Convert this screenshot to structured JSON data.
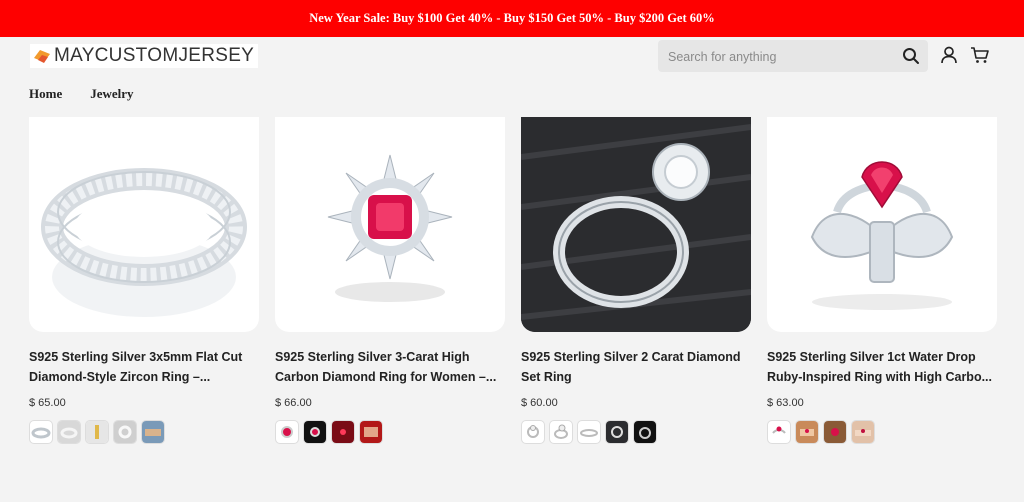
{
  "promo_banner": {
    "text": "New Year Sale: Buy $100 Get 40% - Buy $150 Get 50% - Buy $200 Get 60%",
    "background": "#fe0000"
  },
  "header": {
    "logo_text": "MAYCUSTOMJERSEY",
    "search_placeholder": "Search for anything",
    "icons": [
      "search-icon",
      "user-icon",
      "cart-icon"
    ]
  },
  "nav": {
    "items": [
      {
        "label": "Home"
      },
      {
        "label": "Jewelry"
      }
    ]
  },
  "products": [
    {
      "title": "S925 Sterling Silver 3x5mm Flat Cut Diamond-Style Zircon Ring –...",
      "price": "$ 65.00",
      "image": "eternity-band-ring",
      "swatches": [
        "silver-band",
        "band-on-gray",
        "band-with-gold",
        "band-in-box",
        "band-on-hand"
      ]
    },
    {
      "title": "S925 Sterling Silver 3-Carat High Carbon Diamond Ring for Women –...",
      "price": "$ 66.00",
      "image": "ruby-halo-ring",
      "swatches": [
        "ruby-ring-white",
        "ruby-ring-black",
        "ruby-ring-red",
        "ruby-ring-hand"
      ]
    },
    {
      "title": "S925 Sterling Silver 2 Carat Diamond Set Ring",
      "price": "$ 60.00",
      "image": "diamond-set-ring-dark",
      "swatches": [
        "ring-top-view",
        "ring-side-view",
        "ring-flat-view",
        "ring-dark-view",
        "ring-black-view"
      ]
    },
    {
      "title": "S925 Sterling Silver 1ct Water Drop Ruby-Inspired Ring with High Carbo...",
      "price": "$ 63.00",
      "image": "ruby-bow-ring",
      "swatches": [
        "bow-ring-white",
        "bow-ring-hand",
        "bow-ring-warm",
        "bow-ring-hand-2"
      ]
    }
  ]
}
